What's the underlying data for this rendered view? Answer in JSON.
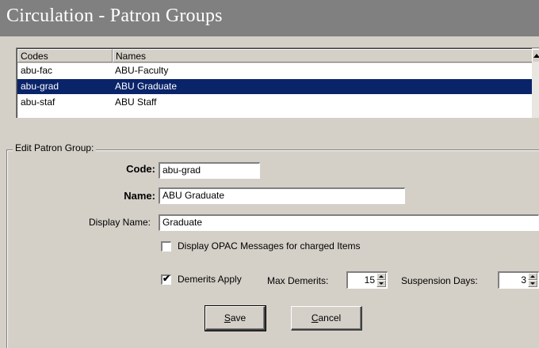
{
  "window": {
    "title": "Circulation - Patron Groups"
  },
  "list": {
    "columns": [
      "Codes",
      "Names"
    ],
    "rows": [
      {
        "code": "abu-fac",
        "name": "ABU-Faculty",
        "selected": false
      },
      {
        "code": "abu-grad",
        "name": "ABU Graduate",
        "selected": true
      },
      {
        "code": "abu-staf",
        "name": "ABU Staff",
        "selected": false
      }
    ]
  },
  "edit": {
    "legend": "Edit Patron Group:",
    "code_label": "Code:",
    "code_value": "abu-grad",
    "name_label": "Name:",
    "name_value": "ABU Graduate",
    "display_label": "Display Name:",
    "display_value": "Graduate",
    "opac_label": "Display OPAC Messages for charged Items",
    "opac_checked": false,
    "demerits_label": "Demerits Apply",
    "demerits_checked": true,
    "max_demerits_label": "Max Demerits:",
    "max_demerits_value": "15",
    "suspension_label": "Suspension Days:",
    "suspension_value": "3"
  },
  "buttons": {
    "save_label": "Save",
    "save_mnemonic": "S",
    "cancel_label": "Cancel",
    "cancel_mnemonic": "C"
  },
  "colors": {
    "selection": "#0a246a",
    "dialog_bg": "#d4d0c8",
    "title_bg": "#808080"
  }
}
